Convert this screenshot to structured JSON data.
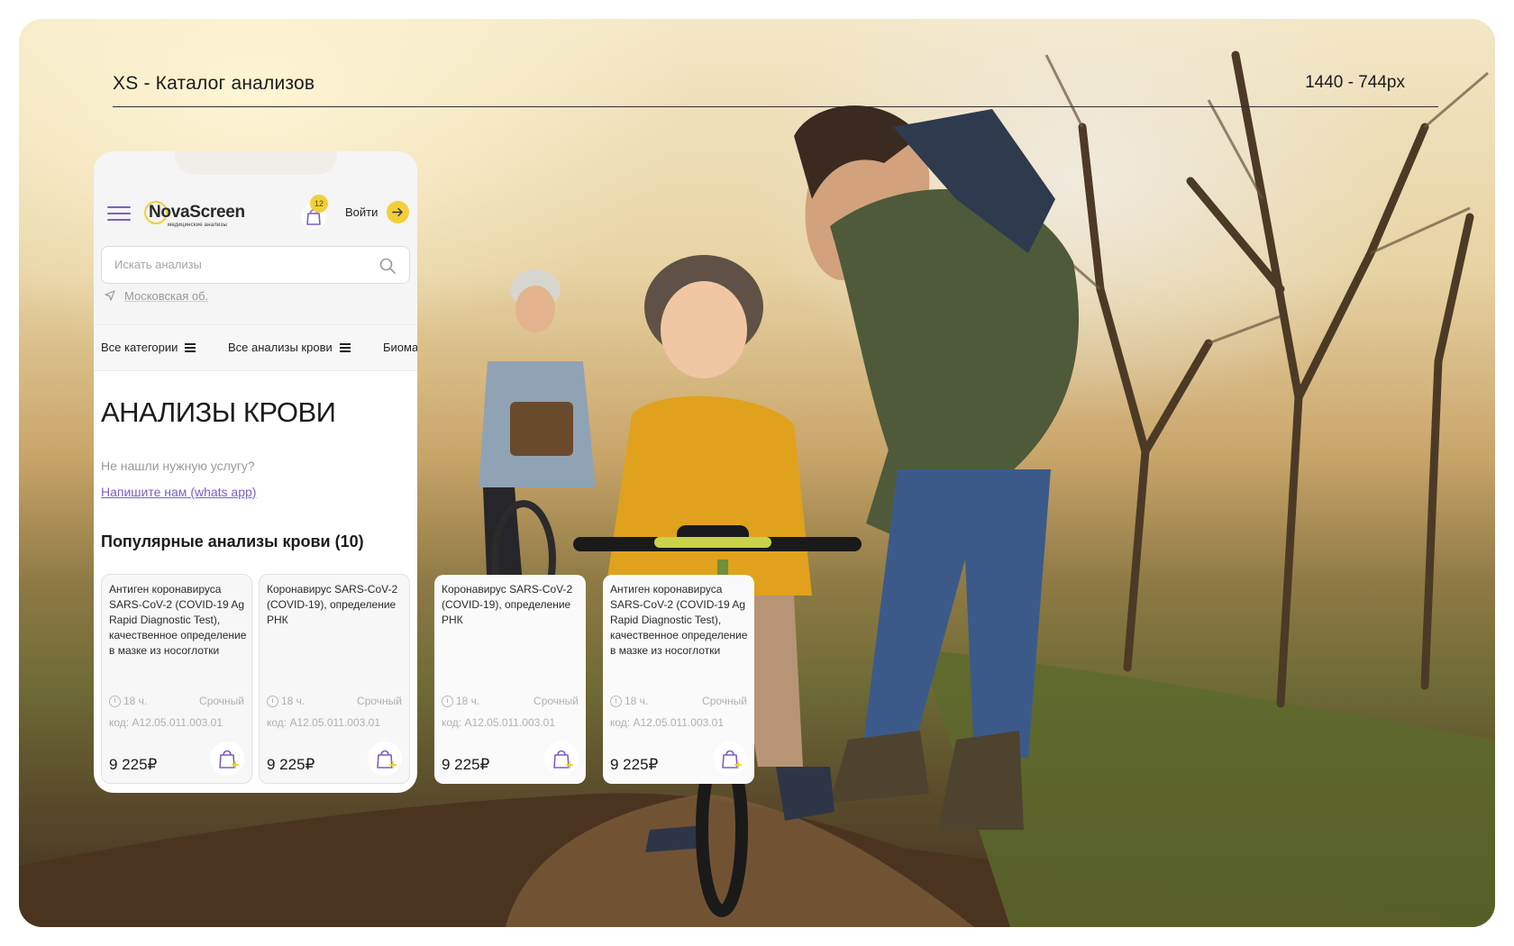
{
  "header": {
    "title": "XS  -  Каталог анализов",
    "size": "1440  -  744px"
  },
  "app": {
    "logo_text": "NovaScreen",
    "logo_sub": "медицинские анализы",
    "cart_count": "12",
    "login_label": "Войти",
    "search_placeholder": "Искать анализы",
    "region": "Московская об.",
    "categories": [
      {
        "label": "Все категории"
      },
      {
        "label": "Все анализы крови"
      },
      {
        "label": "Биома"
      }
    ],
    "page_title": "АНАЛИЗЫ КРОВИ",
    "help_question": "Не нашли нужную услугу?",
    "help_link": "Напишите нам (whats app)",
    "section_title": "Популярные анализы крови (10)"
  },
  "cards": [
    {
      "name": "Антиген коронавируса SARS-CoV-2 (COVID-19 Ag Rapid Diagnostic Test), качественное определение в мазке из носоглотки",
      "time": "18 ч.",
      "urgency": "Срочный",
      "code": "код: A12.05.011.003.01",
      "price": "9 225₽"
    },
    {
      "name": "Коронавирус SARS-CoV-2 (COVID-19), определение РНК",
      "time": "18 ч.",
      "urgency": "Срочный",
      "code": "код: A12.05.011.003.01",
      "price": "9 225₽"
    },
    {
      "name": "Коронавирус SARS-CoV-2 (COVID-19), определение РНК",
      "time": "18 ч.",
      "urgency": "Срочный",
      "code": "код: A12.05.011.003.01",
      "price": "9 225₽"
    },
    {
      "name": "Антиген коронавируса SARS-CoV-2 (COVID-19 Ag Rapid Diagnostic Test), качественное определение в мазке из носоглотки",
      "time": "18 ч.",
      "urgency": "Срочный",
      "code": "код: A12.05.011.003.01",
      "price": "9 225₽"
    }
  ],
  "colors": {
    "accent_purple": "#7b5fc4",
    "accent_yellow": "#f2cf3a"
  }
}
